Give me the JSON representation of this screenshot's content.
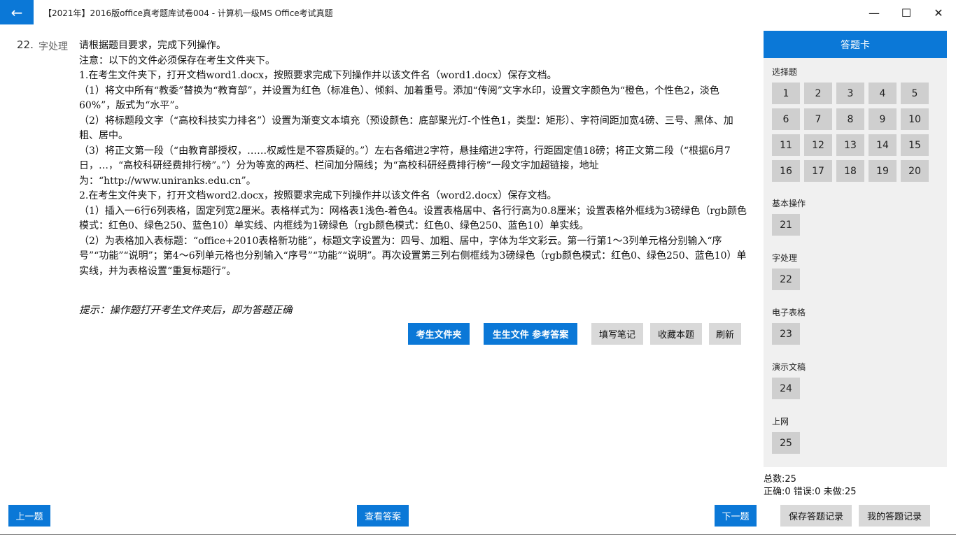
{
  "window": {
    "back_icon": "←",
    "title": "【2021年】2016版office真考题库试卷004 - 计算机一级MS Office考试真题",
    "min_icon": "—",
    "max_icon": "☐",
    "close_icon": "✕"
  },
  "question": {
    "number": "22.",
    "type": "字处理",
    "lines": [
      "请根据题目要求，完成下列操作。",
      "注意：以下的文件必须保存在考生文件夹下。",
      "1.在考生文件夹下，打开文档word1.docx，按照要求完成下列操作并以该文件名（word1.docx）保存文档。",
      "（1）将文中所有“教委”替换为“教育部”，并设置为红色（标准色）、倾斜、加着重号。添加“传阅”文字水印，设置文字颜色为“橙色，个性色2，淡色60%”，版式为“水平”。",
      "（2）将标题段文字（“高校科技实力排名”）设置为渐变文本填充（预设颜色：底部聚光灯-个性色1，类型：矩形）、字符间距加宽4磅、三号、黑体、加粗、居中。",
      "（3）将正文第一段（“由教育部授权，……权威性是不容质疑的。”）左右各缩进2字符，悬挂缩进2字符，行距固定值18磅；将正文第二段（“根据6月7日，…，“高校科研经费排行榜”。”）分为等宽的两栏、栏间加分隔线；为“高校科研经费排行榜”一段文字加超链接，地址为：“http://www.uniranks.edu.cn”。",
      "2.在考生文件夹下，打开文档word2.docx，按照要求完成下列操作并以该文件名（word2.docx）保存文档。",
      "（1）插入一6行6列表格，固定列宽2厘米。表格样式为：网格表1浅色-着色4。设置表格居中、各行行高为0.8厘米；设置表格外框线为3磅绿色（rgb颜色模式：红色0、绿色250、蓝色10）单实线、内框线为1磅绿色（rgb颜色模式：红色0、绿色250、蓝色10）单实线。",
      "（2）为表格加入表标题：“office+2010表格新功能”，标题文字设置为：四号、加粗、居中，字体为华文彩云。第一行第1～3列单元格分别输入“序号”“功能”“说明”；第4～6列单元格也分别输入“序号”“功能”“说明”。再次设置第三列右侧框线为3磅绿色（rgb颜色模式：红色0、绿色250、蓝色10）单实线，并为表格设置“重复标题行”。"
    ],
    "hint": "提示：操作题打开考生文件夹后，即为答题正确"
  },
  "actions": {
    "folder": "考生文件夹",
    "gen_answer": "生生文件 参考答案",
    "notes": "填写笔记",
    "favorite": "收藏本题",
    "refresh": "刷新"
  },
  "nav": {
    "prev": "上一题",
    "view_answer": "查看答案",
    "next": "下一题",
    "save_record": "保存答题记录",
    "my_record": "我的答题记录"
  },
  "answer_card": {
    "title": "答题卡",
    "sections": [
      {
        "label": "选择题",
        "items": [
          "1",
          "2",
          "3",
          "4",
          "5",
          "6",
          "7",
          "8",
          "9",
          "10",
          "11",
          "12",
          "13",
          "14",
          "15",
          "16",
          "17",
          "18",
          "19",
          "20"
        ]
      },
      {
        "label": "基本操作",
        "items": [
          "21"
        ]
      },
      {
        "label": "字处理",
        "items": [
          "22"
        ]
      },
      {
        "label": "电子表格",
        "items": [
          "23"
        ]
      },
      {
        "label": "演示文稿",
        "items": [
          "24"
        ]
      },
      {
        "label": "上网",
        "items": [
          "25"
        ]
      }
    ]
  },
  "stats": {
    "total": "总数:25",
    "summary": "正确:0 错误:0 未做:25"
  }
}
